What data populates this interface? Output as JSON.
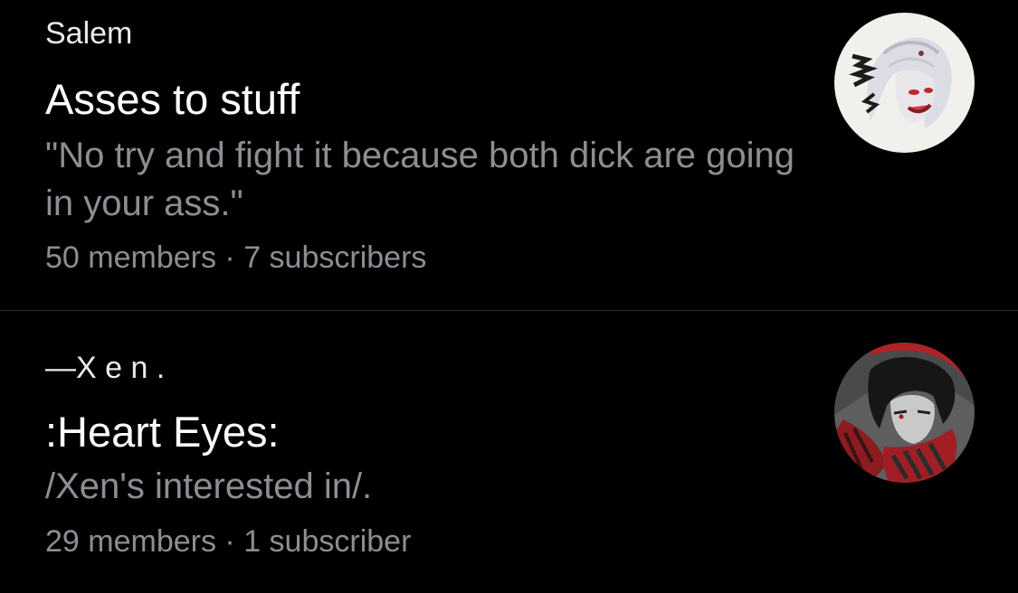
{
  "communities": [
    {
      "owner": "Salem",
      "title": "Asses to stuff",
      "description": "\"No try and fight it because both dick are going in your ass.\"",
      "members": "50 members",
      "separator": "·",
      "subscribers": "7 subscribers",
      "avatar_icon": "anime-character-avatar-white-hair"
    },
    {
      "owner": "—X e n .",
      "title": ":Heart Eyes:",
      "description": "/Xen's interested in/.",
      "members": "29 members",
      "separator": "·",
      "subscribers": "1 subscriber",
      "avatar_icon": "anime-character-avatar-red-scarf"
    }
  ],
  "colors": {
    "background": "#000000",
    "primary_text": "#ffffff",
    "secondary_text": "#8d8d93",
    "divider": "#2b2b2e"
  }
}
